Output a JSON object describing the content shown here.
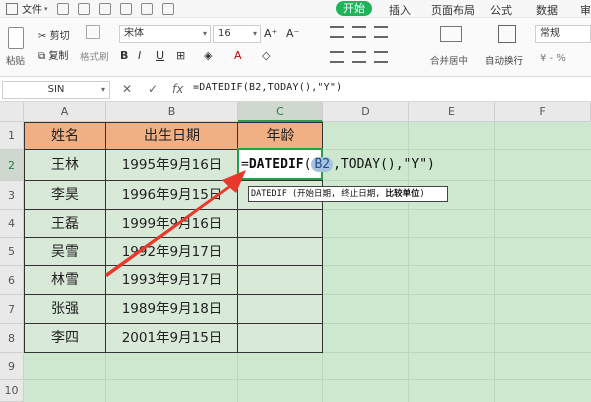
{
  "menubar": {
    "file": "文件",
    "tabs": [
      "开始",
      "插入",
      "页面布局",
      "公式",
      "数据",
      "审"
    ]
  },
  "ribbon": {
    "paste": "粘贴",
    "cut": "剪切",
    "copy": "复制",
    "format_painter": "格式刷",
    "font": "宋体",
    "size": "16",
    "merge_center": "合并居中",
    "wrap_text": "自动换行",
    "number_format": "常规",
    "percent": "¥ - %"
  },
  "formula_bar": {
    "name_box": "SIN",
    "cancel": "✕",
    "confirm": "✓",
    "fx": "fx",
    "formula": "=DATEDIF(B2,TODAY(),\"Y\")"
  },
  "grid": {
    "columns": [
      "A",
      "B",
      "C",
      "D",
      "E",
      "F"
    ],
    "rows": [
      "1",
      "2",
      "3",
      "4",
      "5",
      "6",
      "7",
      "8",
      "9",
      "10"
    ],
    "header": {
      "name": "姓名",
      "birth": "出生日期",
      "age": "年龄"
    },
    "records": [
      {
        "name": "王林",
        "birth": "1995年9月16日"
      },
      {
        "name": "李昊",
        "birth": "1996年9月15日"
      },
      {
        "name": "王磊",
        "birth": "1999年9月16日"
      },
      {
        "name": "吴雪",
        "birth": "1992年9月17日"
      },
      {
        "name": "林雪",
        "birth": "1993年9月17日"
      },
      {
        "name": "张强",
        "birth": "1989年9月18日"
      },
      {
        "name": "李四",
        "birth": "2001年9月15日"
      }
    ],
    "editing_cell": {
      "prefix": "=",
      "function": "DATEDIF",
      "open": "(",
      "ref": "B2",
      "rest": ",TODAY(),\"Y\")"
    },
    "tooltip": {
      "plain": "DATEDIF (开始日期, 终止日期, ",
      "bold": "比较单位",
      "close": ")"
    }
  },
  "colors": {
    "accent": "#1fb35a",
    "header_fill": "#f0b084",
    "sheet_green": "#cde8cf",
    "arrow": "#e8392c"
  }
}
